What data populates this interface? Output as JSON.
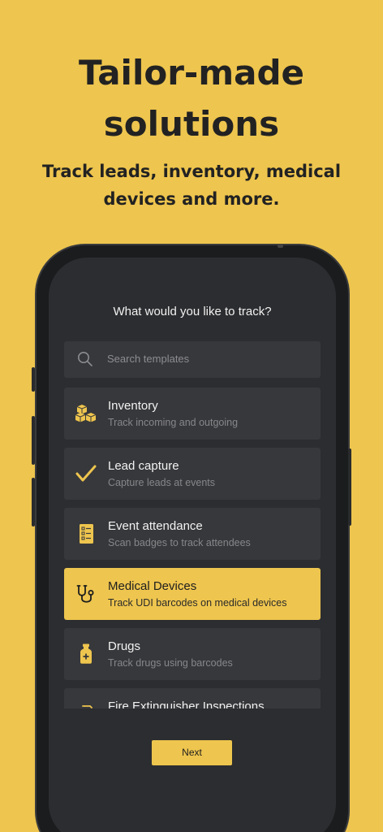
{
  "hero": {
    "title_line1": "Tailor-made",
    "title_line2": "solutions",
    "subtitle_line1": "Track leads, inventory, medical",
    "subtitle_line2": "devices and more."
  },
  "screen": {
    "question": "What would you like to track?",
    "search": {
      "placeholder": "Search templates",
      "icon": "search-icon"
    },
    "templates": [
      {
        "title": "Inventory",
        "description": "Track incoming and outgoing",
        "icon": "boxes-icon",
        "selected": false
      },
      {
        "title": "Lead capture",
        "description": "Capture leads at events",
        "icon": "checkmark-icon",
        "selected": false
      },
      {
        "title": "Event attendance",
        "description": "Scan badges to track attendees",
        "icon": "checklist-icon",
        "selected": false
      },
      {
        "title": "Medical Devices",
        "description": "Track UDI barcodes on medical devices",
        "icon": "stethoscope-icon",
        "selected": true
      },
      {
        "title": "Drugs",
        "description": "Track drugs using barcodes",
        "icon": "medicine-bottle-icon",
        "selected": false
      },
      {
        "title": "Fire Extinguisher Inspections",
        "description": "",
        "icon": "fire-extinguisher-icon",
        "selected": false
      }
    ],
    "next_label": "Next"
  },
  "colors": {
    "background": "#EEC54E",
    "screen": "#2C2D30",
    "card": "#37383B",
    "accent": "#EEC54E",
    "text_dark": "#222222"
  }
}
